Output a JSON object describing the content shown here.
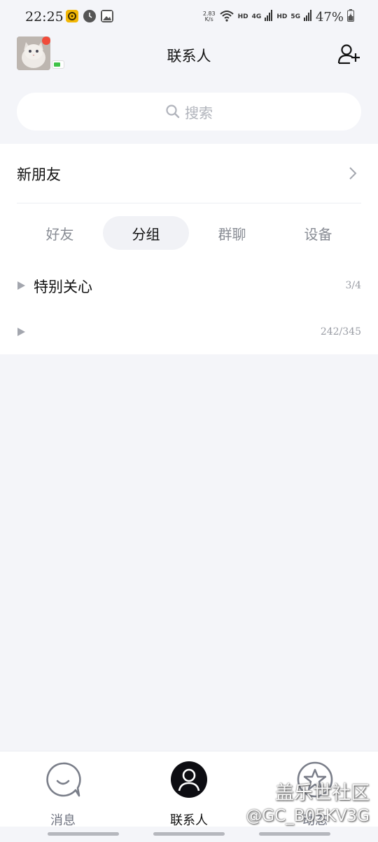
{
  "status_bar": {
    "time": "22:25",
    "speed_value": "2.83",
    "speed_unit": "K/s",
    "hd1": "HD",
    "net1": "4G",
    "hd2": "HD",
    "net2": "5G",
    "battery": "47%"
  },
  "header": {
    "title": "联系人"
  },
  "search": {
    "placeholder": "搜索"
  },
  "new_friends": {
    "label": "新朋友"
  },
  "tabs": [
    {
      "label": "好友",
      "active": false
    },
    {
      "label": "分组",
      "active": true
    },
    {
      "label": "群聊",
      "active": false
    },
    {
      "label": "设备",
      "active": false
    }
  ],
  "groups": [
    {
      "name": "特别关心",
      "count": "3/4"
    },
    {
      "name": "",
      "count": "242/345"
    }
  ],
  "bottom_nav": [
    {
      "label": "消息",
      "icon": "chat-icon",
      "active": false
    },
    {
      "label": "联系人",
      "icon": "contacts-icon",
      "active": true
    },
    {
      "label": "动态",
      "icon": "star-icon",
      "active": false
    }
  ],
  "watermark": {
    "line1": "盖乐世社区",
    "line2": "@GC_B05KV3G"
  },
  "colors": {
    "background": "#f4f5f9",
    "card": "#ffffff",
    "active_tab_bg": "#f1f2f6",
    "avatar_badge": "#f04b3a",
    "online": "#3ec247"
  }
}
